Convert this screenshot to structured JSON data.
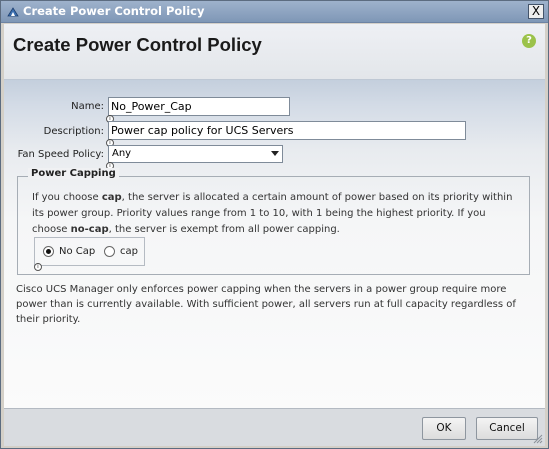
{
  "window": {
    "title": "Create Power Control Policy",
    "close_glyph": "X",
    "icon": "app-icon"
  },
  "header": {
    "title": "Create Power Control Policy",
    "help_glyph": "?"
  },
  "form": {
    "name_label": "Name:",
    "name_value": "No_Power_Cap",
    "description_label": "Description:",
    "description_value": "Power cap policy for UCS Servers",
    "fan_label": "Fan Speed Policy:",
    "fan_value": "Any",
    "info_glyph": "i"
  },
  "power_capping": {
    "legend": "Power Capping",
    "text_1": "If you choose ",
    "text_cap": "cap",
    "text_2": ", the server is allocated a certain amount of power based on its priority within its power group. Priority values range from 1 to 10, with 1 being the highest priority. If you choose ",
    "text_nocap": "no-cap",
    "text_3": ", the server is exempt from all power capping.",
    "options": [
      {
        "label": "No Cap",
        "checked": true
      },
      {
        "label": "cap",
        "checked": false
      }
    ]
  },
  "note": "Cisco UCS Manager only enforces power capping when the servers in a power group require more power than is currently available. With sufficient power, all servers run at full capacity regardless of their priority.",
  "footer": {
    "ok_label": "OK",
    "cancel_label": "Cancel"
  }
}
